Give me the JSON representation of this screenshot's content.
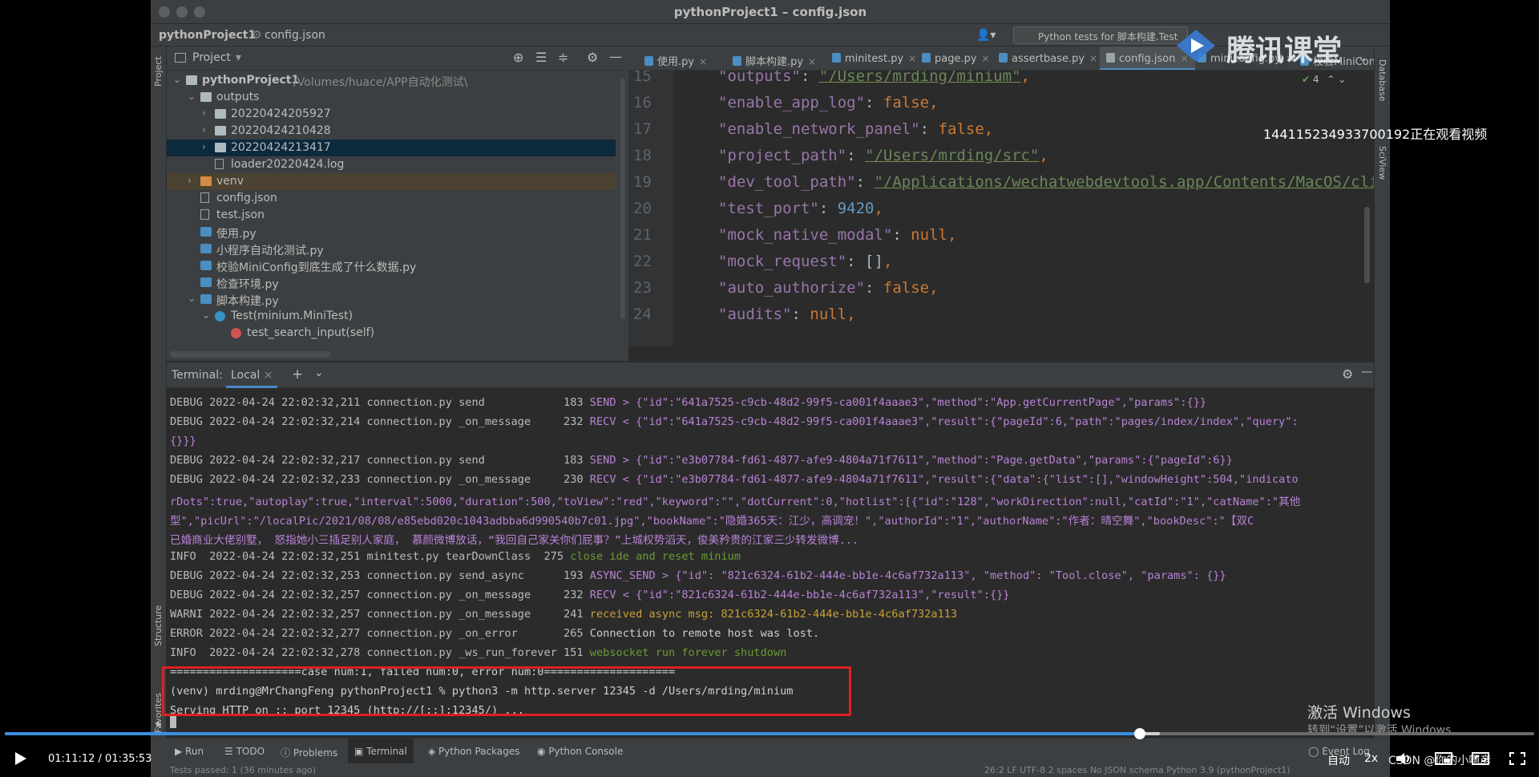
{
  "window": {
    "title": "pythonProject1 – config.json"
  },
  "navbar": {
    "project": "pythonProject1",
    "file": "config.json",
    "run_config": "Python tests for 脚本构建.Test"
  },
  "project_panel": {
    "title": "Project",
    "items": [
      {
        "label": "pythonProject1",
        "extra": "/Volumes/huace/APP自动化测试\\",
        "kind": "folder"
      },
      {
        "label": "outputs",
        "kind": "folder"
      },
      {
        "label": "20220424205927",
        "kind": "folder"
      },
      {
        "label": "20220424210428",
        "kind": "folder"
      },
      {
        "label": "20220424213417",
        "kind": "folder"
      },
      {
        "label": "loader20220424.log",
        "kind": "file"
      },
      {
        "label": "venv",
        "kind": "folder"
      },
      {
        "label": "config.json",
        "kind": "file"
      },
      {
        "label": "test.json",
        "kind": "file"
      },
      {
        "label": "使用.py",
        "kind": "py"
      },
      {
        "label": "小程序自动化测试.py",
        "kind": "py"
      },
      {
        "label": "校验MiniConfig到底生成了什么数据.py",
        "kind": "py"
      },
      {
        "label": "检查环境.py",
        "kind": "py"
      },
      {
        "label": "脚本构建.py",
        "kind": "py"
      },
      {
        "label": "Test(minium.MiniTest)",
        "kind": "class"
      },
      {
        "label": "test_search_input(self)",
        "kind": "method"
      }
    ]
  },
  "left_strip": {
    "project": "Project",
    "structure": "Structure",
    "favorites": "Favorites"
  },
  "right_strip": {
    "database": "Database",
    "sciview": "SciView"
  },
  "tabs": [
    {
      "label": "使用.py"
    },
    {
      "label": "脚本构建.py"
    },
    {
      "label": "minitest.py"
    },
    {
      "label": "page.py"
    },
    {
      "label": "assertbase.py"
    },
    {
      "label": "config.json"
    },
    {
      "label": "miniconfig.py"
    },
    {
      "label": "校验MiniConfig"
    }
  ],
  "editor": {
    "inspection_count": "4",
    "lines": [
      {
        "num": "15",
        "key": "\"outputs\"",
        "value": "\"/Users/mrding/minium\"",
        "type": "str"
      },
      {
        "num": "16",
        "key": "\"enable_app_log\"",
        "value": "false",
        "type": "kw"
      },
      {
        "num": "17",
        "key": "\"enable_network_panel\"",
        "value": "false",
        "type": "kw"
      },
      {
        "num": "18",
        "key": "\"project_path\"",
        "value": "\"/Users/mrding/src\"",
        "type": "str"
      },
      {
        "num": "19",
        "key": "\"dev_tool_path\"",
        "value": "\"/Applications/wechatwebdevtools.app/Contents/MacOS/cli\"",
        "type": "str"
      },
      {
        "num": "20",
        "key": "\"test_port\"",
        "value": "9420",
        "type": "num"
      },
      {
        "num": "21",
        "key": "\"mock_native_modal\"",
        "value": "null",
        "type": "kw"
      },
      {
        "num": "22",
        "key": "\"mock_request\"",
        "value": "[]",
        "type": "plain"
      },
      {
        "num": "23",
        "key": "\"auto_authorize\"",
        "value": "false",
        "type": "kw"
      },
      {
        "num": "24",
        "key": "\"audits\"",
        "value": "null",
        "type": "kw"
      }
    ]
  },
  "terminal": {
    "label": "Terminal:",
    "tab": "Local",
    "lines": [
      {
        "prefix": "DEBUG 2022-04-24 22:02:32,211 connection.py send            183 ",
        "body": "SEND > {\"id\":\"641a7525-c9cb-48d2-99f5-ca001f4aaae3\",\"method\":\"App.getCurrentPage\",\"params\":{}}",
        "color": "purple"
      },
      {
        "prefix": "DEBUG 2022-04-24 22:02:32,214 connection.py _on_message     232 ",
        "body": "RECV < {\"id\":\"641a7525-c9cb-48d2-99f5-ca001f4aaae3\",\"result\":{\"pageId\":6,\"path\":\"pages/index/index\",\"query\":",
        "color": "purple"
      },
      {
        "prefix": "",
        "body": "{}}}",
        "color": "purple"
      },
      {
        "prefix": "DEBUG 2022-04-24 22:02:32,217 connection.py send            183 ",
        "body": "SEND > {\"id\":\"e3b07784-fd61-4877-afe9-4804a71f7611\",\"method\":\"Page.getData\",\"params\":{\"pageId\":6}}",
        "color": "purple"
      },
      {
        "prefix": "DEBUG 2022-04-24 22:02:32,233 connection.py _on_message     230 ",
        "body": "RECV < {\"id\":\"e3b07784-fd61-4877-afe9-4804a71f7611\",\"result\":{\"data\":{\"list\":[],\"windowHeight\":504,\"indicato",
        "color": "purple"
      },
      {
        "prefix": "",
        "body": "rDots\":true,\"autoplay\":true,\"interval\":5000,\"duration\":500,\"toView\":\"red\",\"keyword\":\"\",\"dotCurrent\":0,\"hotlist\":[{\"id\":\"128\",\"workDirection\":null,\"catId\":\"1\",\"catName\":\"其他",
        "color": "purple"
      },
      {
        "prefix": "",
        "body": "型\",\"picUrl\":\"/localPic/2021/08/08/e85ebd020c1043adbba6d990540b7c01.jpg\",\"bookName\":\"隐婚365天：江少，高调宠！\",\"authorId\":\"1\",\"authorName\":\"作者：晴空舞\",\"bookDesc\":\"【双C",
        "color": "purple"
      },
      {
        "prefix": "",
        "body": "已婚商业大佬别墅， 怒指她小三插足别人家庭， 慕颜微博放话，“我回自己家关你们屁事？”上城权势滔天，俊美矜贵的江家三少转发微博...",
        "color": "purple"
      },
      {
        "prefix": "INFO  2022-04-24 22:02:32,251 minitest.py tearDownClass  275 ",
        "body": "close ide and reset minium",
        "color": "green"
      },
      {
        "prefix": "DEBUG 2022-04-24 22:02:32,253 connection.py send_async      193 ",
        "body": "ASYNC_SEND > {\"id\": \"821c6324-61b2-444e-bb1e-4c6af732a113\", \"method\": \"Tool.close\", \"params\": {}}",
        "color": "purple"
      },
      {
        "prefix": "DEBUG 2022-04-24 22:02:32,257 connection.py _on_message     232 ",
        "body": "RECV < {\"id\":\"821c6324-61b2-444e-bb1e-4c6af732a113\",\"result\":{}}",
        "color": "purple"
      },
      {
        "prefix": "WARNI 2022-04-24 22:02:32,257 connection.py _on_message     241 ",
        "body": "received async msg: 821c6324-61b2-444e-bb1e-4c6af732a113",
        "color": "yellow"
      },
      {
        "prefix": "ERROR 2022-04-24 22:02:32,277 connection.py _on_error       265 ",
        "body": "Connection to remote host was lost.",
        "color": "white"
      },
      {
        "prefix": "INFO  2022-04-24 22:02:32,278 connection.py _ws_run_forever 151 ",
        "body": "websocket run forever shutdown",
        "color": "green"
      },
      {
        "prefix": "",
        "body": "====================case num:1, failed num:0, error num:0====================",
        "color": "white"
      },
      {
        "prefix": "",
        "body": "(venv) mrding@MrChangFeng pythonProject1 % python3 -m http.server 12345 -d /Users/mrding/minium",
        "color": "white"
      },
      {
        "prefix": "",
        "body": "Serving HTTP on :: port 12345 (http://[::]:12345/) ...",
        "color": "white"
      }
    ]
  },
  "bottom_tools": [
    {
      "label": "Run"
    },
    {
      "label": "TODO"
    },
    {
      "label": "Problems"
    },
    {
      "label": "Terminal"
    },
    {
      "label": "Python Packages"
    },
    {
      "label": "Python Console"
    },
    {
      "label": "Event Log"
    }
  ],
  "status": {
    "left": "Tests passed: 1 (36 minutes ago)",
    "right": "26:2   LF   UTF-8   2 spaces   No JSON schema   Python 3.9 (pythonProject1)"
  },
  "overlay": {
    "logo_text": "腾讯课堂",
    "viewer_id": "144115234933700192正在观看视频",
    "activate_title": "激活 Windows",
    "activate_sub": "转到“设置”以激活 Windows"
  },
  "player": {
    "current_time": "01:11:12",
    "total_time": "01:35:53",
    "progress": 0.742,
    "buffered": 0.755,
    "quality": "自动",
    "speed": "2x",
    "credit": "CSDN @你的小啊彦"
  },
  "colors": {
    "accent": "#3a8fe0",
    "highlight": "#e02020"
  }
}
